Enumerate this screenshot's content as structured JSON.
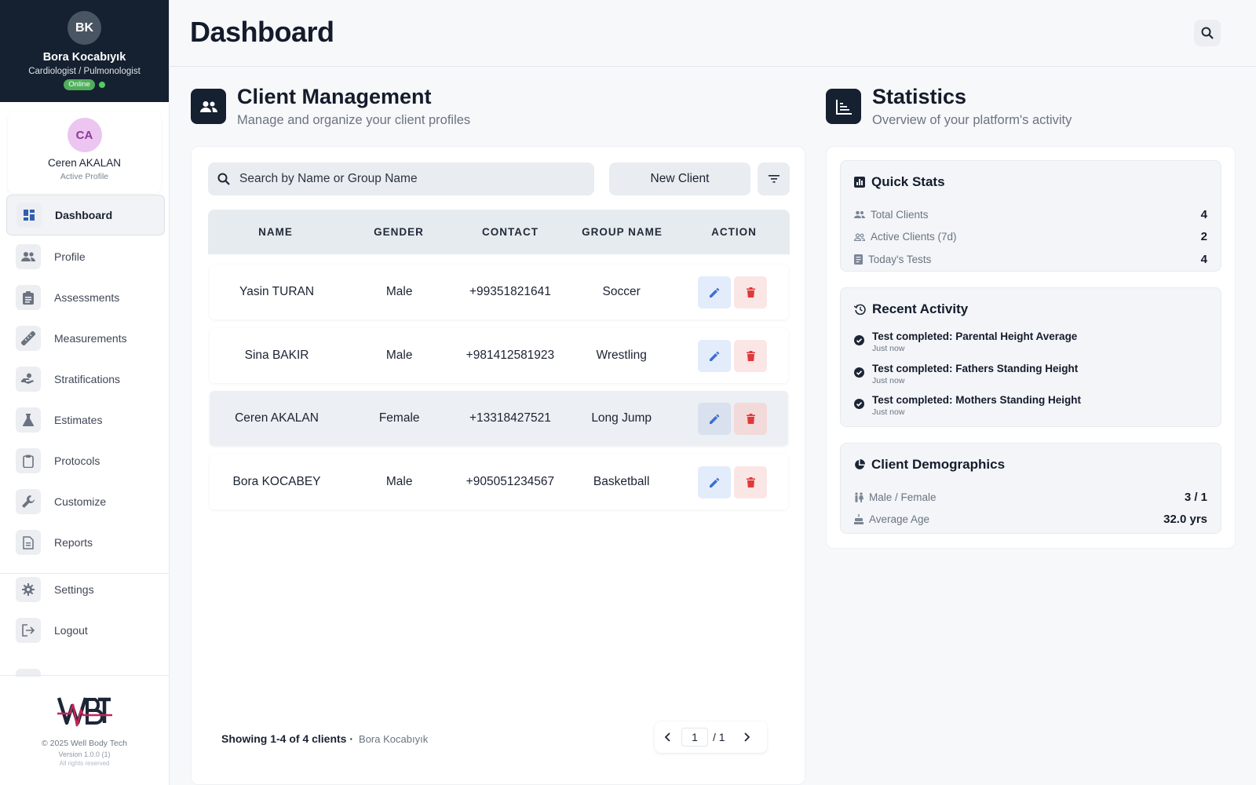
{
  "user": {
    "initials": "BK",
    "name": "Bora Kocabıyık",
    "role": "Cardiologist / Pulmonologist",
    "status": "Online"
  },
  "active_profile": {
    "initials": "CA",
    "name": "Ceren AKALAN",
    "label": "Active Profile"
  },
  "nav": [
    {
      "label": "Dashboard",
      "icon": "dashboard-icon",
      "active": true
    },
    {
      "label": "Profile",
      "icon": "people-icon"
    },
    {
      "label": "Assessments",
      "icon": "clipboard-list-icon"
    },
    {
      "label": "Measurements",
      "icon": "ruler-icon"
    },
    {
      "label": "Stratifications",
      "icon": "hand-person-icon"
    },
    {
      "label": "Estimates",
      "icon": "flask-icon"
    },
    {
      "label": "Protocols",
      "icon": "clipboard-icon"
    },
    {
      "label": "Customize",
      "icon": "wrench-icon"
    },
    {
      "label": "Reports",
      "icon": "document-icon"
    },
    {
      "label": "Settings",
      "icon": "gear-icon"
    },
    {
      "label": "Logout",
      "icon": "logout-icon"
    }
  ],
  "footer": {
    "logo_text": "WBT",
    "copyright": "© 2025 Well Body Tech",
    "version": "Version 1.0.0 (1)",
    "rights": "All rights reserved"
  },
  "header": {
    "title": "Dashboard"
  },
  "clients_section": {
    "title": "Client Management",
    "subtitle": "Manage and organize your client profiles",
    "search_placeholder": "Search by Name or Group Name",
    "new_client_label": "New Client",
    "columns": [
      "NAME",
      "GENDER",
      "CONTACT",
      "GROUP NAME",
      "ACTION"
    ],
    "rows": [
      {
        "name": "Yasin TURAN",
        "gender": "Male",
        "contact": "+99351821641",
        "group": "Soccer"
      },
      {
        "name": "Sina BAKIR",
        "gender": "Male",
        "contact": "+981412581923",
        "group": "Wrestling"
      },
      {
        "name": "Ceren AKALAN",
        "gender": "Female",
        "contact": "+13318427521",
        "group": "Long Jump",
        "selected": true
      },
      {
        "name": "Bora KOCABEY",
        "gender": "Male",
        "contact": "+905051234567",
        "group": "Basketball"
      }
    ],
    "showing": "Showing 1-4 of 4 clients ·",
    "showing_user": "Bora Kocabıyık",
    "page": "1",
    "page_total": "/ 1"
  },
  "stats_section": {
    "title": "Statistics",
    "subtitle": "Overview of your platform's activity",
    "quick_stats": {
      "title": "Quick Stats",
      "items": [
        {
          "label": "Total Clients",
          "value": "4"
        },
        {
          "label": "Active Clients (7d)",
          "value": "2"
        },
        {
          "label": "Today's Tests",
          "value": "4"
        }
      ]
    },
    "recent_activity": {
      "title": "Recent Activity",
      "items": [
        {
          "title": "Test completed: Parental Height Average",
          "time": "Just now"
        },
        {
          "title": "Test completed: Fathers Standing Height",
          "time": "Just now"
        },
        {
          "title": "Test completed: Mothers Standing Height",
          "time": "Just now"
        }
      ]
    },
    "demographics": {
      "title": "Client Demographics",
      "items": [
        {
          "label": "Male / Female",
          "value": "3 / 1"
        },
        {
          "label": "Average Age",
          "value": "32.0 yrs"
        }
      ]
    }
  },
  "colors": {
    "sidebar_header": "#152030",
    "accent_dark": "#152030",
    "edit": "#3b6fd4",
    "delete": "#e0393b",
    "online": "#4fae5a"
  }
}
